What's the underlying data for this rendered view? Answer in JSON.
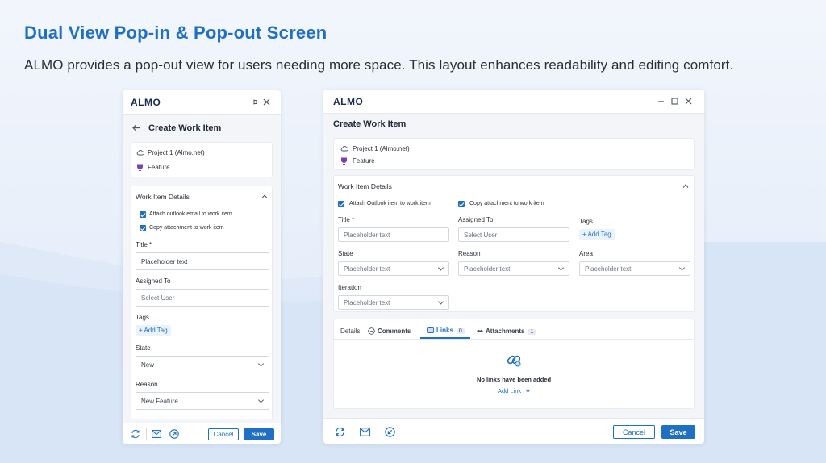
{
  "heading": "Dual View Pop-in & Pop-out Screen",
  "subheading": "ALMO provides a pop-out view for users needing more space. This layout enhances readability and editing comfort.",
  "colors": {
    "accent": "#1f6fc5",
    "feature_icon": "#7b3fb7"
  },
  "left_panel": {
    "logo_text": "ALMO",
    "page_title": "Create Work Item",
    "project": "Project 1 (Almo.net)",
    "item_type": "Feature",
    "section_title": "Work Item Details",
    "checkbox_outlook": "Attach outlook email to work item",
    "checkbox_copy": "Copy attachment to work item",
    "title_label": "Title *",
    "title_placeholder": "Placeholder text",
    "assigned_label": "Assigned To",
    "assigned_placeholder": "Select User",
    "tags_label": "Tags",
    "add_tag": "+ Add Tag",
    "state_label": "State",
    "state_value": "New",
    "reason_label": "Reason",
    "reason_value": "New Feature",
    "cancel": "Cancel",
    "save": "Save"
  },
  "right_panel": {
    "logo_text": "ALMO",
    "page_title": "Create Work Item",
    "project": "Project 1 (Almo.net)",
    "item_type": "Feature",
    "section_title": "Work Item Details",
    "checkbox_outlook": "Attach Outlook item to work item",
    "checkbox_copy": "Copy attachment to work item",
    "title_label": "Title",
    "title_required": "*",
    "title_placeholder": "Placeholder text",
    "assigned_label": "Assigned To",
    "assigned_placeholder": "Select User",
    "tags_label": "Tags",
    "add_tag": "+ Add Tag",
    "state_label": "State",
    "state_placeholder": "Placeholder text",
    "reason_label": "Reason",
    "reason_placeholder": "Placeholder text",
    "area_label": "Area",
    "area_placeholder": "Placeholder text",
    "iteration_label": "Iteration",
    "iteration_placeholder": "Placeholder text",
    "tabs": {
      "details": "Details",
      "comments": "Comments",
      "links": "Links",
      "links_count": "0",
      "attachments": "Attachments",
      "attachments_count": "1"
    },
    "empty_links": "No links have been added",
    "add_link": "Add Link",
    "cancel": "Cancel",
    "save": "Save"
  }
}
